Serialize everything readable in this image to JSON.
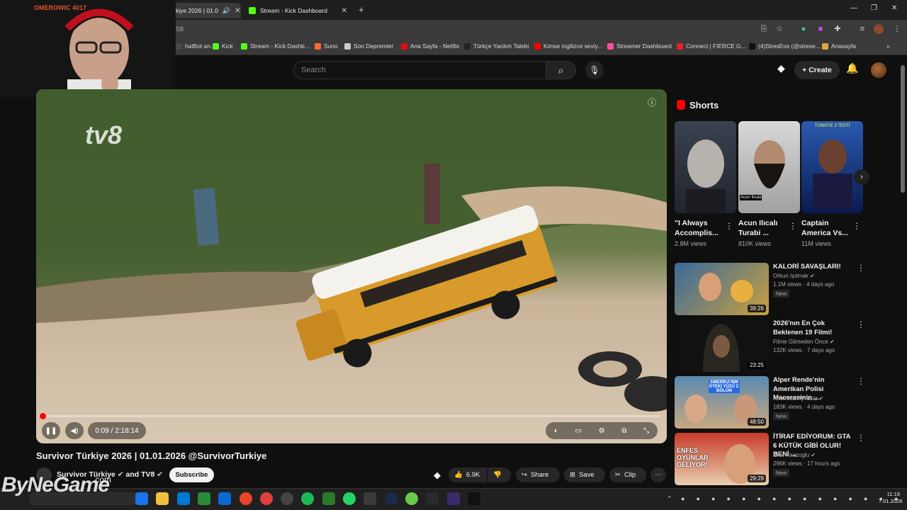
{
  "browser": {
    "tabs": [
      {
        "label": "kiye 2026 | 01.0",
        "active": true
      },
      {
        "label": "Stream - Kick Dashboard",
        "active": false
      }
    ],
    "url_fragment": "S8",
    "bookmarks": [
      {
        "label": "hatBot an...",
        "color": "#4a4a4a"
      },
      {
        "label": "Kick",
        "color": "#53fc18"
      },
      {
        "label": "Stream - Kick Dashb...",
        "color": "#53fc18"
      },
      {
        "label": "Suno",
        "color": "#ff6a2a"
      },
      {
        "label": "Son Depremler",
        "color": "#cccccc"
      },
      {
        "label": "Ana Sayfa - Netflix",
        "color": "#e50914"
      },
      {
        "label": "Türkçe Yardım Talebi",
        "color": "#222222"
      },
      {
        "label": "Kimse ingilizce seviy...",
        "color": "#ff0000"
      },
      {
        "label": "Streamer Dashboard",
        "color": "#ff4fa0"
      },
      {
        "label": "Connect | FIERCE G...",
        "color": "#e0202a"
      },
      {
        "label": "(4)StresEos (@strese...",
        "color": "#111111"
      },
      {
        "label": "Anasayfa",
        "color": "#d9a93a"
      }
    ]
  },
  "header": {
    "search_placeholder": "Search",
    "create_label": "Create"
  },
  "player": {
    "time": "0:09 / 2:18:14",
    "progress": 0.001,
    "channel_logo": "tv8"
  },
  "video": {
    "title": "Survivor Türkiye 2026 | 01.01.2026 @SurvivorTurkiye",
    "channel": "Survivor Türkiye",
    "channel_and": "and TV8",
    "subscribe_label": "Subscribe",
    "likes": "6.9K",
    "share_label": "Share",
    "save_label": "Save",
    "clip_label": "Clip"
  },
  "shorts": {
    "heading": "Shorts",
    "items": [
      {
        "title": "\"I Always Accomplis...",
        "views": "2.8M views"
      },
      {
        "title": "Acun Ilıcalı Turabi ...",
        "views": "810K views",
        "overlay": "Acun Ilıcalı"
      },
      {
        "title": "Captain America Vs...",
        "views": "11M views",
        "overlay": "TÜRKİYE 3 TESTİ"
      }
    ]
  },
  "recommended": [
    {
      "title": "KALORİ SAVAŞLARI!",
      "channel": "Orkun Işıtmak",
      "stats": "1.1M views · 4 days ago",
      "badge": "New",
      "duration": "39:26",
      "verified": true
    },
    {
      "title": "2026'nın En Çok Beklenen 19 Filmi!",
      "channel": "Filme Gitmeden Önce",
      "stats": "132K views · 7 days ago",
      "badge": "",
      "duration": "23:25",
      "verified": true
    },
    {
      "title": "Alper Rende'nin Amerikan Polisi Macerasinin ...",
      "channel": "Amerikali Aynasiz",
      "stats": "183K views · 4 days ago",
      "badge": "New",
      "duration": "48:50",
      "verified": true,
      "overlay": "AMERİKA'NIN ÖTEKİ YÜZÜ 2. BÖLÜM"
    },
    {
      "title": "İTİRAF EDİYORUM: GTA 6 KÜTÜK GİBİ OLUR! BENİ ...",
      "channel": "Enis Kirazoglu",
      "stats": "296K views · 17 hours ago",
      "badge": "New",
      "duration": "29:29",
      "verified": true,
      "overlay": "ENFES OYUNLAR GELİYOR!"
    }
  ],
  "overlay": {
    "streamer": "OMEROWIC 4017",
    "watermark": "ByNeGame",
    "watermark_suffix": ".com"
  },
  "taskbar": {
    "time": "11:19",
    "date": "7.01.2026"
  },
  "colors": {
    "accent": "#ff0000",
    "kick": "#53fc18"
  }
}
